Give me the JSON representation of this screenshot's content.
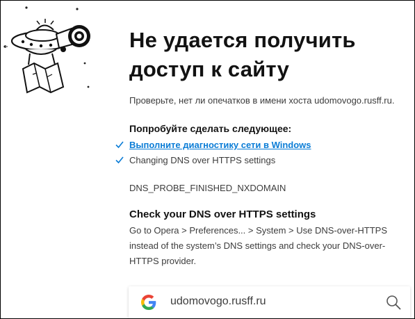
{
  "page": {
    "title": "Не удается получить доступ к сайту",
    "description": "Проверьте, нет ли опечатков в имени хоста udomovogo.rusff.ru.",
    "suggestions_heading": "Попробуйте сделать следующее:",
    "suggestions": [
      {
        "label": "Выполните диагностику сети в Windows",
        "is_link": true
      },
      {
        "label": "Changing DNS over HTTPS settings",
        "is_link": false
      }
    ],
    "error_code": "DNS_PROBE_FINISHED_NXDOMAIN",
    "doh_heading": "Check your DNS over HTTPS settings",
    "doh_text": "Go to Opera > Preferences... > System > Use DNS-over-HTTPS instead of the system’s DNS settings and check your DNS-over-HTTPS provider."
  },
  "search": {
    "query": "udomovogo.rusff.ru",
    "engine_icon": "google-logo-icon",
    "action_icon": "magnifier-icon"
  },
  "illustration": {
    "icon": "ufo-telescope-illustration"
  },
  "colors": {
    "link": "#0a7cd6",
    "check": "#0a7cd6",
    "title": "#121212",
    "body": "#3c3c3c"
  }
}
